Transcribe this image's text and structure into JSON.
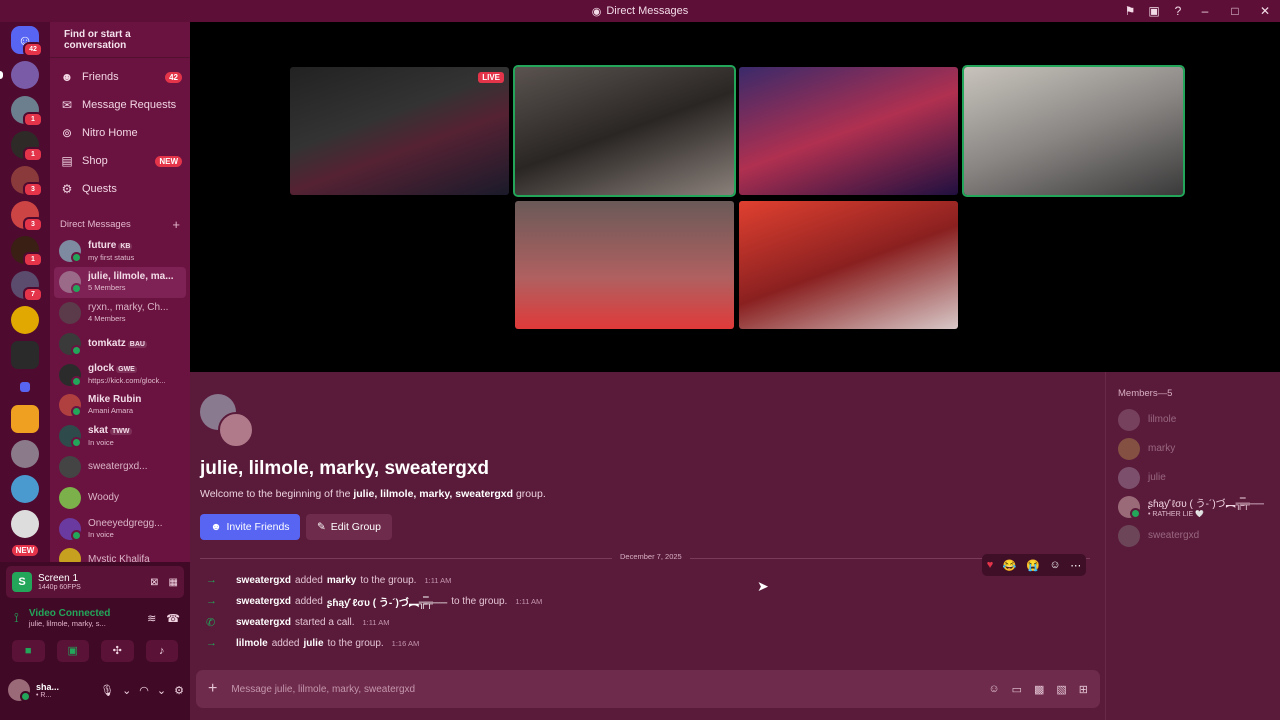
{
  "window": {
    "title": "Direct Messages"
  },
  "colors": {
    "titlebar": "#5e0f38",
    "sidebar": "#6a1340",
    "chat": "#5a1b3a",
    "accent": "#5865f2",
    "online": "#23a55a",
    "badge": "#e3344a"
  },
  "rail": {
    "home_badge": "42",
    "servers": [
      {
        "badge": ""
      },
      {
        "badge": "1"
      },
      {
        "badge": "1"
      },
      {
        "badge": "3"
      },
      {
        "badge": "3"
      },
      {
        "badge": "1"
      },
      {
        "badge": "7"
      },
      {
        "badge": ""
      },
      {
        "badge": ""
      },
      {
        "badge": ""
      },
      {
        "badge": ""
      },
      {
        "badge": ""
      },
      {
        "badge": ""
      },
      {
        "badge": ""
      }
    ],
    "new_label": "NEW"
  },
  "sidebar": {
    "search_label": "Find or start a conversation",
    "nav": [
      {
        "label": "Friends",
        "count": "42",
        "icon": "friends-icon"
      },
      {
        "label": "Message Requests",
        "count": "",
        "icon": "envelope-icon"
      },
      {
        "label": "Nitro Home",
        "count": "",
        "icon": "nitro-icon"
      },
      {
        "label": "Shop",
        "count": "NEW",
        "icon": "shop-icon"
      },
      {
        "label": "Quests",
        "count": "",
        "icon": "quests-icon"
      }
    ],
    "dm_header": "Direct Messages",
    "dms": [
      {
        "name": "future",
        "tag": "KB",
        "sub": "my first status"
      },
      {
        "name": "julie, lilmole, ma...",
        "tag": "",
        "sub": "5 Members"
      },
      {
        "name": "ryxn., marky, Ch...",
        "tag": "",
        "sub": "4 Members"
      },
      {
        "name": "tomkatz",
        "tag": "BAU",
        "sub": ""
      },
      {
        "name": "glock",
        "tag": "GWE",
        "sub": "https://kick.com/glock..."
      },
      {
        "name": "Mike Rubin",
        "tag": "",
        "sub": "Amani Amara"
      },
      {
        "name": "skat",
        "tag": "TWW",
        "sub": "In voice"
      },
      {
        "name": "sweatergxd...",
        "tag": "",
        "sub": ""
      },
      {
        "name": "Woody",
        "tag": "",
        "sub": ""
      },
      {
        "name": "Oneeyedgregg...",
        "tag": "",
        "sub": "In voice"
      },
      {
        "name": "Mystic Khalifa",
        "tag": "",
        "sub": ""
      }
    ]
  },
  "voice": {
    "screen_title": "Screen 1",
    "screen_quality": "1440p 60FPS",
    "status": "Video Connected",
    "channel": "julie, lilmole, marky, s...",
    "user_name": "sha...",
    "user_sub": "• R..."
  },
  "stage": {
    "live_label": "LIVE"
  },
  "chat": {
    "group_title": "julie, lilmole, marky, sweatergxd",
    "welcome_prefix": "Welcome to the beginning of the ",
    "welcome_names": "julie, lilmole, marky, sweatergxd",
    "welcome_suffix": " group.",
    "invite_label": "Invite Friends",
    "edit_label": "Edit Group",
    "date": "December 7, 2025",
    "events": [
      {
        "actor": "sweatergxd",
        "verb": "added",
        "target": "marky",
        "rest": "to the group.",
        "time": "1:11 AM",
        "icon": "arrow-right-icon"
      },
      {
        "actor": "sweatergxd",
        "verb": "added",
        "target": "ʂɦąƴ ℓσυ ( う-´)づ︻╦̵̵̿╤──",
        "rest": "to the group.",
        "time": "1:11 AM",
        "icon": "arrow-right-icon"
      },
      {
        "actor": "sweatergxd",
        "verb": "started a call.",
        "target": "",
        "rest": "",
        "time": "1:11 AM",
        "icon": "phone-icon"
      },
      {
        "actor": "lilmole",
        "verb": "added",
        "target": "julie",
        "rest": "to the group.",
        "time": "1:16 AM",
        "icon": "arrow-right-icon"
      }
    ],
    "composer_placeholder": "Message julie, lilmole, marky, sweatergxd"
  },
  "members": {
    "header": "Members—5",
    "list": [
      {
        "name": "lilmole",
        "sub": "",
        "online": false
      },
      {
        "name": "marky",
        "sub": "",
        "online": false
      },
      {
        "name": "julie",
        "sub": "",
        "online": false
      },
      {
        "name": "ʂɦąƴ ℓσυ ( う-´)づ︻╦̵̵̿╤──",
        "sub": "• RATHER LIE 🤍",
        "online": true
      },
      {
        "name": "sweatergxd",
        "sub": "",
        "online": false
      }
    ]
  }
}
